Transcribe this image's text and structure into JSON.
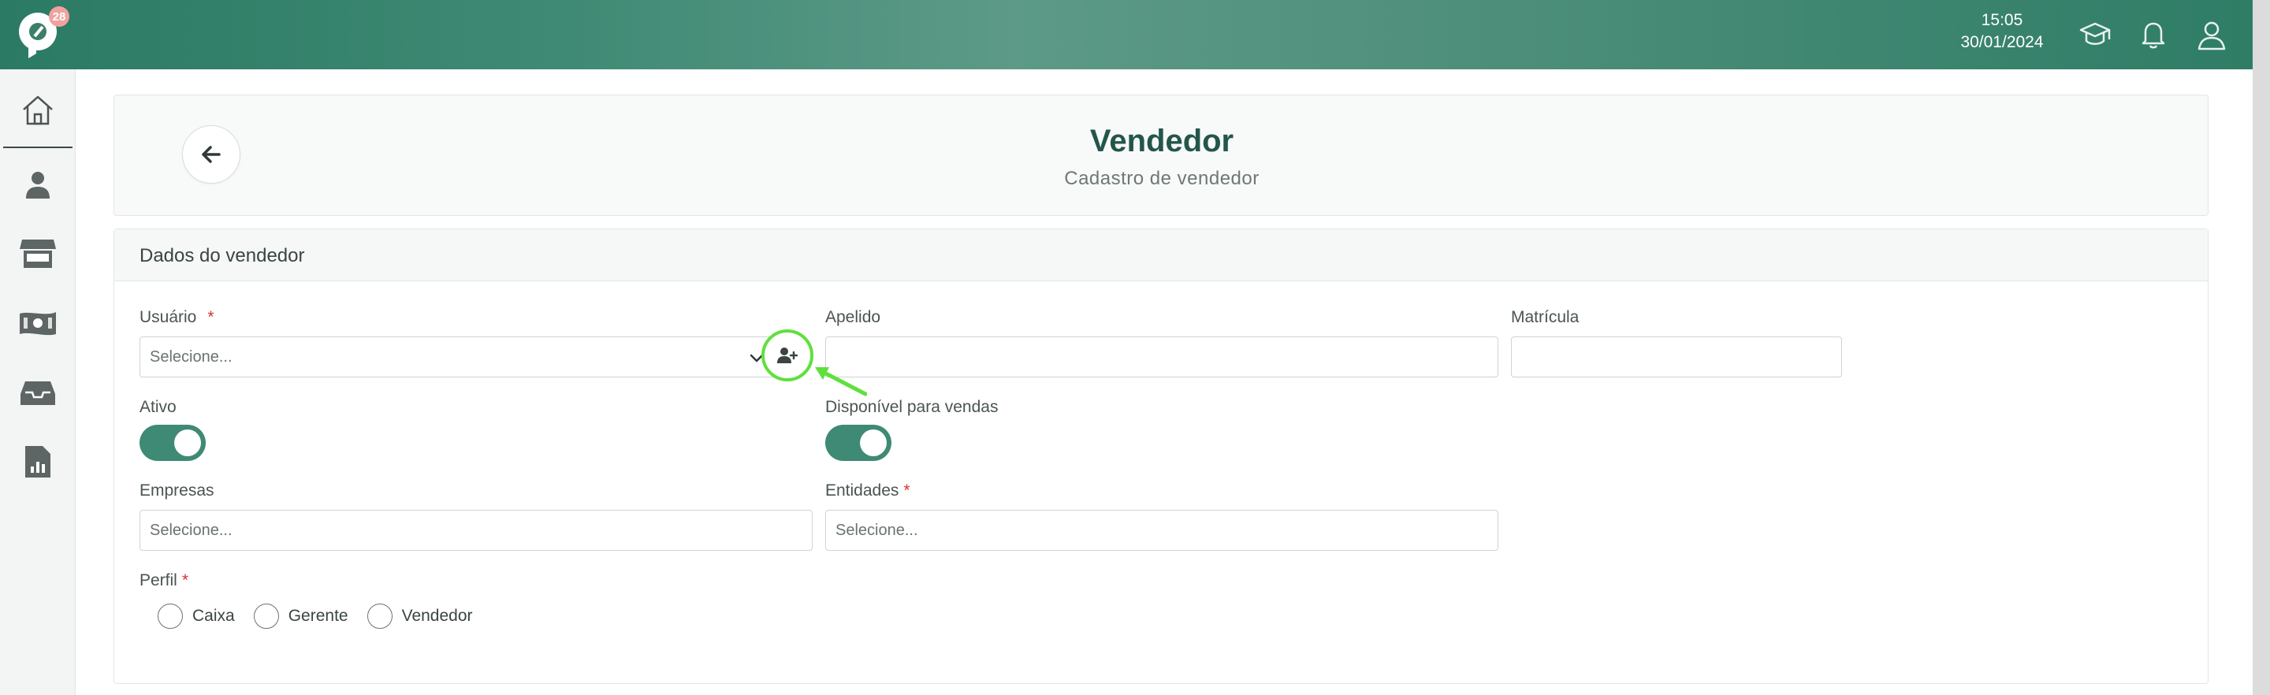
{
  "app": {
    "notification_count": "28",
    "time": "15:05",
    "date": "30/01/2024"
  },
  "topbar": {
    "icons": [
      "graduation-cap-icon",
      "bell-icon",
      "user-profile-icon"
    ]
  },
  "sidebar": {
    "items": [
      {
        "icon": "home-icon"
      },
      {
        "icon": "person-icon"
      },
      {
        "icon": "store-icon"
      },
      {
        "icon": "money-icon"
      },
      {
        "icon": "inbox-icon"
      },
      {
        "icon": "report-icon"
      }
    ]
  },
  "header": {
    "title": "Vendedor",
    "subtitle": "Cadastro de vendedor"
  },
  "form": {
    "section_title": "Dados do vendedor",
    "usuario": {
      "label": "Usuário",
      "required_mark": "*",
      "placeholder": "Selecione..."
    },
    "apelido": {
      "label": "Apelido",
      "value": ""
    },
    "matricula": {
      "label": "Matrícula",
      "value": ""
    },
    "ativo": {
      "label": "Ativo",
      "on": true
    },
    "disponivel": {
      "label": "Disponível para vendas",
      "on": true
    },
    "empresas": {
      "label": "Empresas",
      "placeholder": "Selecione..."
    },
    "entidades": {
      "label": "Entidades",
      "required_mark": "*",
      "placeholder": "Selecione..."
    },
    "perfil": {
      "label": "Perfil",
      "required_mark": "*",
      "options": [
        "Caixa",
        "Gerente",
        "Vendedor"
      ]
    }
  },
  "colors": {
    "brand_green": "#3f8a74",
    "title_green": "#23564a",
    "required_red": "#d9322b",
    "annotation_green": "#5fe03d"
  }
}
